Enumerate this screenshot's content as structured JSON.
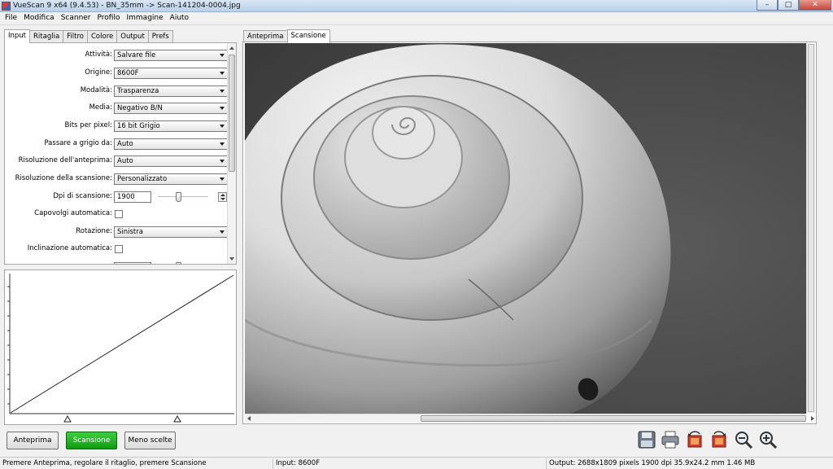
{
  "window": {
    "title": "VueScan 9 x64 (9.4.53) - BN_35mm -> Scan-141204-0004.jpg",
    "minimize": "–",
    "maximize": "□",
    "close": "✕"
  },
  "menu": [
    "File",
    "Modifica",
    "Scanner",
    "Profilo",
    "Immagine",
    "Aiuto"
  ],
  "left_tabs": [
    "Input",
    "Ritaglia",
    "Filtro",
    "Colore",
    "Output",
    "Prefs"
  ],
  "right_tabs": [
    "Anteprima",
    "Scansione"
  ],
  "settings": {
    "attivita": {
      "label": "Attività:",
      "value": "Salvare file"
    },
    "origine": {
      "label": "Origine:",
      "value": "8600F"
    },
    "modalita": {
      "label": "Modalità:",
      "value": "Trasparenza"
    },
    "media": {
      "label": "Media:",
      "value": "Negativo B/N"
    },
    "bits": {
      "label": "Bits per pixel:",
      "value": "16 bit Grigio"
    },
    "grigio": {
      "label": "Passare a grigio da:",
      "value": "Auto"
    },
    "ris_anteprima": {
      "label": "Risoluzione dell'anteprima:",
      "value": "Auto"
    },
    "ris_scansione": {
      "label": "Risoluzione della scansione:",
      "value": "Personalizzato"
    },
    "dpi": {
      "label": "Dpi di scansione:",
      "value": "1900"
    },
    "capovolgi": {
      "label": "Capovolgi automatica:",
      "checked": false
    },
    "rotazione": {
      "label": "Rotazione:",
      "value": "Sinistra"
    },
    "inclinazione": {
      "label": "Inclinazione automatica:",
      "checked": false
    }
  },
  "buttons": {
    "anteprima": "Anteprima",
    "scansione": "Scansione",
    "meno_scelte": "Meno scelte"
  },
  "toolbar_icons": [
    "save-icon",
    "print-icon",
    "rotate-left-icon",
    "rotate-right-icon",
    "zoom-out-icon",
    "zoom-in-icon"
  ],
  "status": {
    "hint": "Premere Anteprima, regolare il ritaglio, premere Scansione",
    "input": "Input: 8600F",
    "output": "Output: 2688x1809 pixels 1900 dpi 35.9x24.2 mm 1.46 MB"
  },
  "colors": {
    "scan_button": "#1aa61a",
    "title_bar": "#c4d8ee"
  }
}
